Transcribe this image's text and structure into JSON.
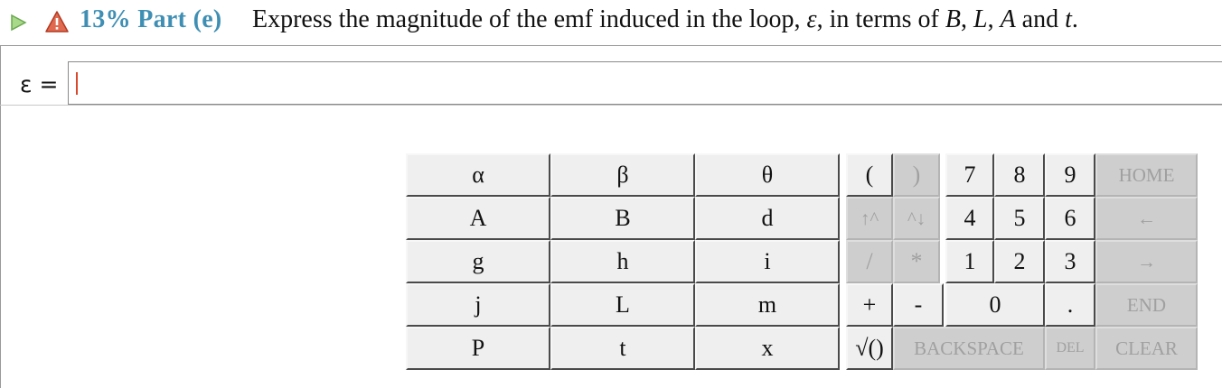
{
  "header": {
    "percent": "13%",
    "part": "Part (e)",
    "question_prefix": "Express the magnitude of the emf induced in the loop,",
    "question_var": "ε",
    "question_mid": ", in terms of",
    "question_vars": [
      "B",
      "L",
      "A"
    ],
    "question_and": "and",
    "question_last": "t",
    "question_end": "."
  },
  "answer": {
    "label": "ε =",
    "value": ""
  },
  "colors": {
    "accent": "#3f8fb4",
    "warning": "#d9482b",
    "play": "#8fc86b",
    "key_bg": "#efefef",
    "key_disabled_bg": "#cecece"
  },
  "keypad": {
    "variables": [
      [
        "α",
        "β",
        "θ"
      ],
      [
        "A",
        "B",
        "d"
      ],
      [
        "g",
        "h",
        "i"
      ],
      [
        "j",
        "L",
        "m"
      ],
      [
        "P",
        "t",
        "x"
      ]
    ],
    "open_paren": "(",
    "close_paren": ")",
    "up_caret": "↑^",
    "caret_down": "^↓",
    "divide": "/",
    "multiply": "*",
    "plus": "+",
    "minus": "-",
    "sqrt": "√()",
    "digits": [
      "7",
      "8",
      "9",
      "4",
      "5",
      "6",
      "1",
      "2",
      "3",
      "0"
    ],
    "dot": ".",
    "backspace": "BACKSPACE",
    "del": "DEL",
    "home": "HOME",
    "left": "←",
    "right": "→",
    "end": "END",
    "clear": "CLEAR"
  }
}
